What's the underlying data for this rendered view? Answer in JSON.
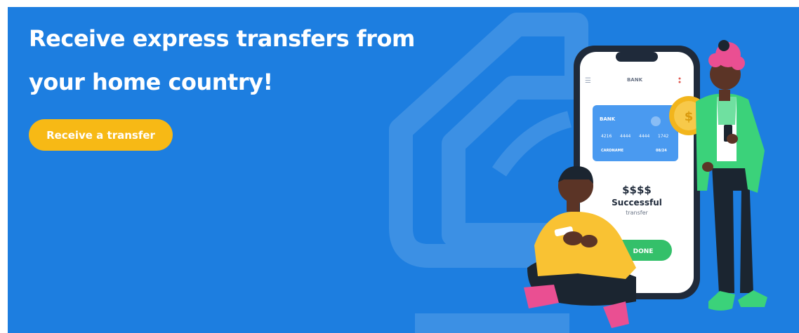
{
  "banner": {
    "headline_line1": "Receive express transfers from",
    "headline_line2": "your home country!",
    "cta_label": "Receive a transfer"
  },
  "phone": {
    "header_label": "BANK",
    "card": {
      "bank_label": "BANK",
      "number_groups": [
        "4216",
        "4444",
        "4444",
        "1742"
      ],
      "holder": "CARDNAME",
      "expiry": "08/24"
    },
    "amount": "$$$$",
    "status": "Successful",
    "status_sub": "transfer",
    "done_label": "DONE"
  },
  "colors": {
    "banner_bg": "#1d7ee0",
    "cta_bg": "#f7b915",
    "headline": "#ffffff",
    "card_bg": "#4a9af0",
    "done_button": "#34c06a"
  }
}
